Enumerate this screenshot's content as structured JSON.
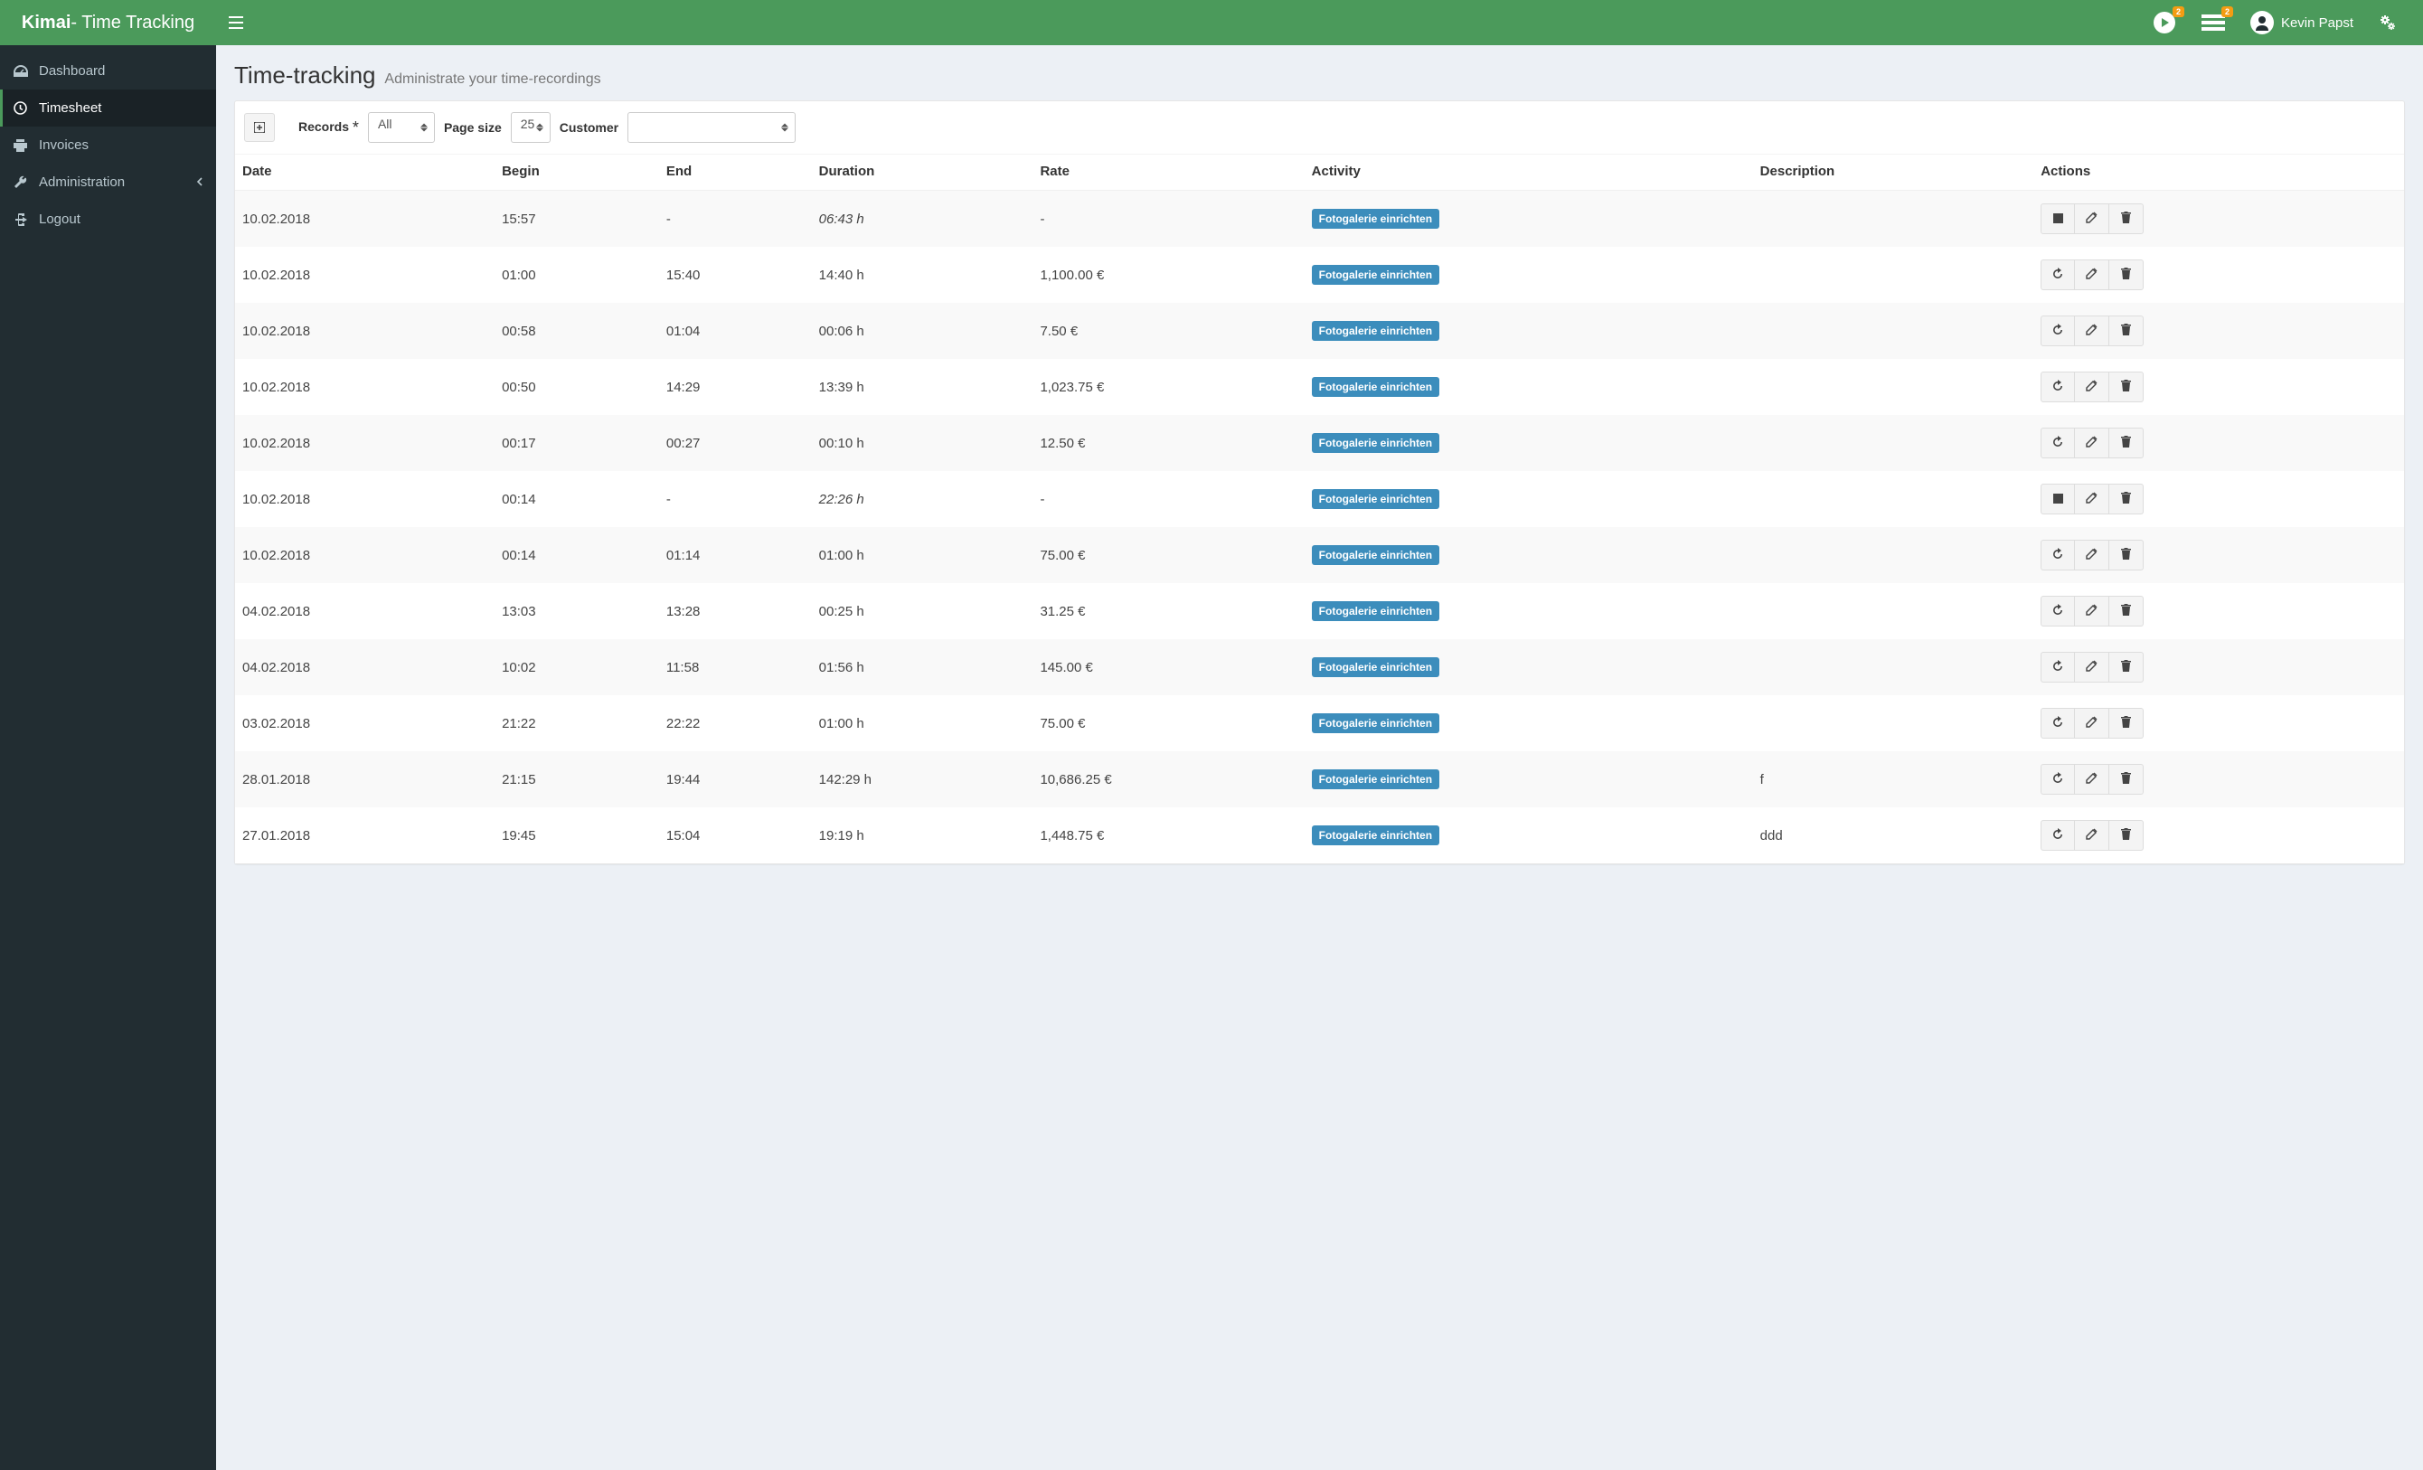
{
  "brand": {
    "strong": "Kimai",
    "light": " - Time Tracking"
  },
  "header": {
    "play_badge": "2",
    "list_badge": "2",
    "user_name": "Kevin Papst"
  },
  "sidebar": {
    "items": [
      {
        "label": "Dashboard",
        "icon": "dashboard"
      },
      {
        "label": "Timesheet",
        "icon": "clock",
        "active": true
      },
      {
        "label": "Invoices",
        "icon": "print"
      },
      {
        "label": "Administration",
        "icon": "wrench",
        "has_children": true
      },
      {
        "label": "Logout",
        "icon": "signout"
      }
    ]
  },
  "page": {
    "title": "Time-tracking",
    "subtitle": "Administrate your time-recordings"
  },
  "filters": {
    "records_label": "Records",
    "records_value": "All",
    "pagesize_label": "Page size",
    "pagesize_value": "25",
    "customer_label": "Customer",
    "customer_value": ""
  },
  "table": {
    "columns": [
      "Date",
      "Begin",
      "End",
      "Duration",
      "Rate",
      "Activity",
      "Description",
      "Actions"
    ],
    "rows": [
      {
        "date": "10.02.2018",
        "begin": "15:57",
        "end": "-",
        "duration": "06:43 h",
        "duration_italic": true,
        "rate": "-",
        "activity": "Fotogalerie einrichten",
        "description": "",
        "running": true
      },
      {
        "date": "10.02.2018",
        "begin": "01:00",
        "end": "15:40",
        "duration": "14:40 h",
        "rate": "1,100.00 €",
        "activity": "Fotogalerie einrichten",
        "description": "",
        "running": false
      },
      {
        "date": "10.02.2018",
        "begin": "00:58",
        "end": "01:04",
        "duration": "00:06 h",
        "rate": "7.50 €",
        "activity": "Fotogalerie einrichten",
        "description": "",
        "running": false
      },
      {
        "date": "10.02.2018",
        "begin": "00:50",
        "end": "14:29",
        "duration": "13:39 h",
        "rate": "1,023.75 €",
        "activity": "Fotogalerie einrichten",
        "description": "",
        "running": false
      },
      {
        "date": "10.02.2018",
        "begin": "00:17",
        "end": "00:27",
        "duration": "00:10 h",
        "rate": "12.50 €",
        "activity": "Fotogalerie einrichten",
        "description": "",
        "running": false
      },
      {
        "date": "10.02.2018",
        "begin": "00:14",
        "end": "-",
        "duration": "22:26 h",
        "duration_italic": true,
        "rate": "-",
        "activity": "Fotogalerie einrichten",
        "description": "",
        "running": true
      },
      {
        "date": "10.02.2018",
        "begin": "00:14",
        "end": "01:14",
        "duration": "01:00 h",
        "rate": "75.00 €",
        "activity": "Fotogalerie einrichten",
        "description": "",
        "running": false
      },
      {
        "date": "04.02.2018",
        "begin": "13:03",
        "end": "13:28",
        "duration": "00:25 h",
        "rate": "31.25 €",
        "activity": "Fotogalerie einrichten",
        "description": "",
        "running": false
      },
      {
        "date": "04.02.2018",
        "begin": "10:02",
        "end": "11:58",
        "duration": "01:56 h",
        "rate": "145.00 €",
        "activity": "Fotogalerie einrichten",
        "description": "",
        "running": false
      },
      {
        "date": "03.02.2018",
        "begin": "21:22",
        "end": "22:22",
        "duration": "01:00 h",
        "rate": "75.00 €",
        "activity": "Fotogalerie einrichten",
        "description": "",
        "running": false
      },
      {
        "date": "28.01.2018",
        "begin": "21:15",
        "end": "19:44",
        "duration": "142:29 h",
        "rate": "10,686.25 €",
        "activity": "Fotogalerie einrichten",
        "description": "f",
        "running": false
      },
      {
        "date": "27.01.2018",
        "begin": "19:45",
        "end": "15:04",
        "duration": "19:19 h",
        "rate": "1,448.75 €",
        "activity": "Fotogalerie einrichten",
        "description": "ddd",
        "running": false
      }
    ]
  }
}
